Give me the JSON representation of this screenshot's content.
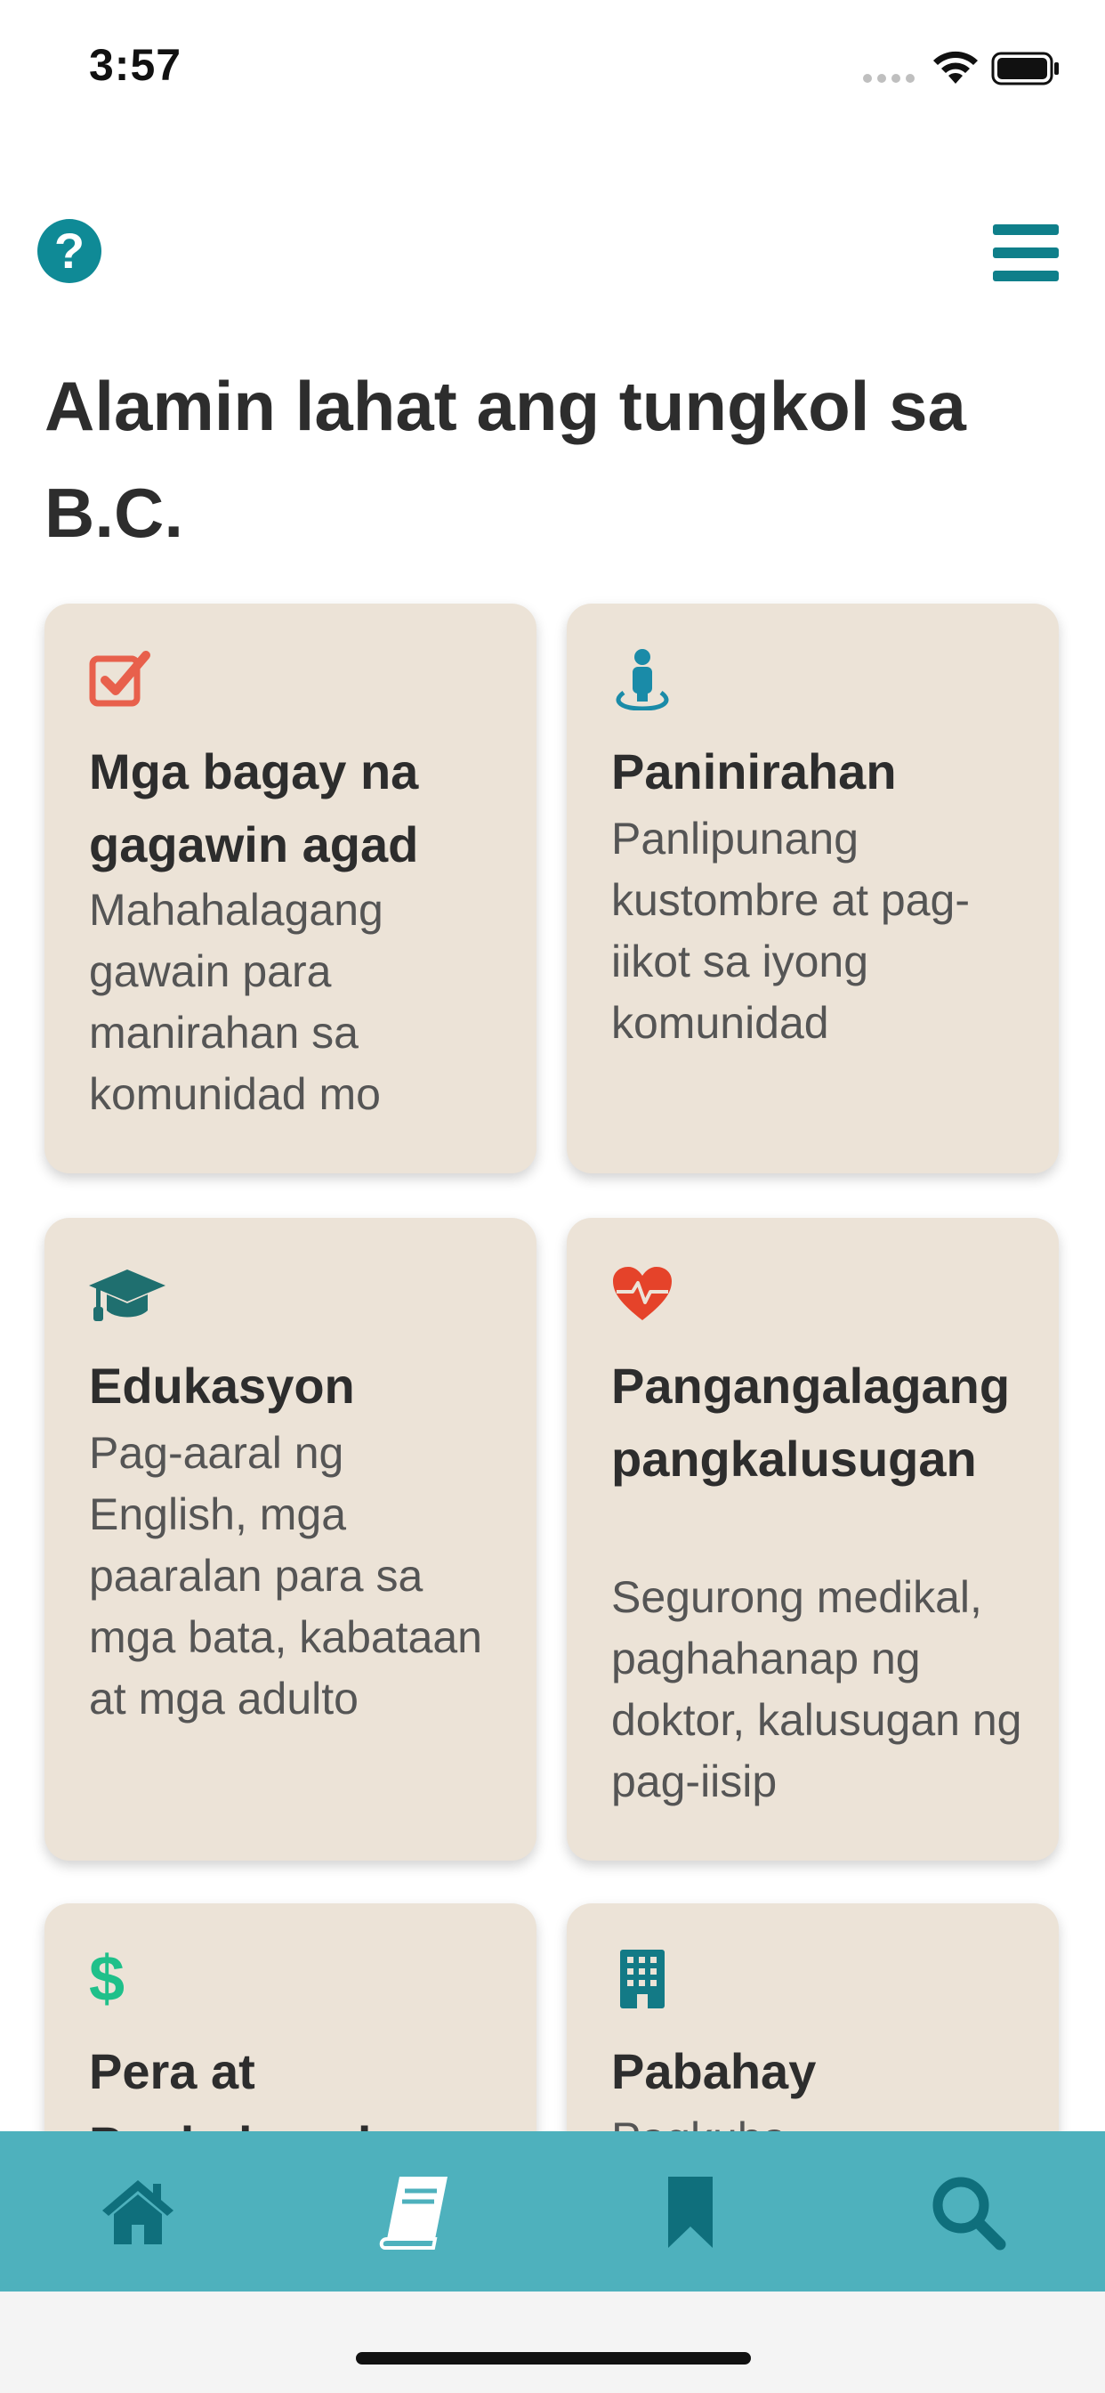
{
  "status_bar": {
    "time": "3:57"
  },
  "header": {
    "help_icon": "question-circle-icon",
    "menu_icon": "hamburger-menu-icon"
  },
  "page_title": "Alamin lahat ang tungkol sa B.C.",
  "cards": [
    {
      "icon": "checkbox-icon",
      "title": "Mga bagay na gagawin agad",
      "description": "Mahahalagang gawain para manirahan sa komunidad mo"
    },
    {
      "icon": "person-location-icon",
      "title": "Paninirahan",
      "description": "Panlipunang kustombre at pag-iikot sa iyong komunidad"
    },
    {
      "icon": "graduation-cap-icon",
      "title": "Edukasyon",
      "description": "Pag-aaral ng English, mga paaralan para sa mga bata, kabataan at mga adulto"
    },
    {
      "icon": "heartbeat-icon",
      "title": "Pangangalagang pangkalusugan",
      "description": "Segurong medikal, paghahanap ng doktor, kalusugan ng pag-iisip"
    },
    {
      "icon": "dollar-icon",
      "title": "Pera at Pagbabangko",
      "description": ""
    },
    {
      "icon": "building-icon",
      "title": "Pabahay",
      "description": "Pagkuha..."
    }
  ],
  "tab_bar": {
    "tabs": [
      {
        "name": "home",
        "icon": "home-icon"
      },
      {
        "name": "guide",
        "icon": "book-icon",
        "active": true
      },
      {
        "name": "bookmarks",
        "icon": "bookmark-icon"
      },
      {
        "name": "search",
        "icon": "search-icon"
      }
    ]
  },
  "colors": {
    "accent": "#0f8a96",
    "card_bg": "#ece3d7",
    "tab_bar_bg": "#4eb1bd",
    "checkbox_icon": "#e8604c",
    "heart_icon": "#e5432a",
    "dollar_icon": "#1fc08a"
  }
}
